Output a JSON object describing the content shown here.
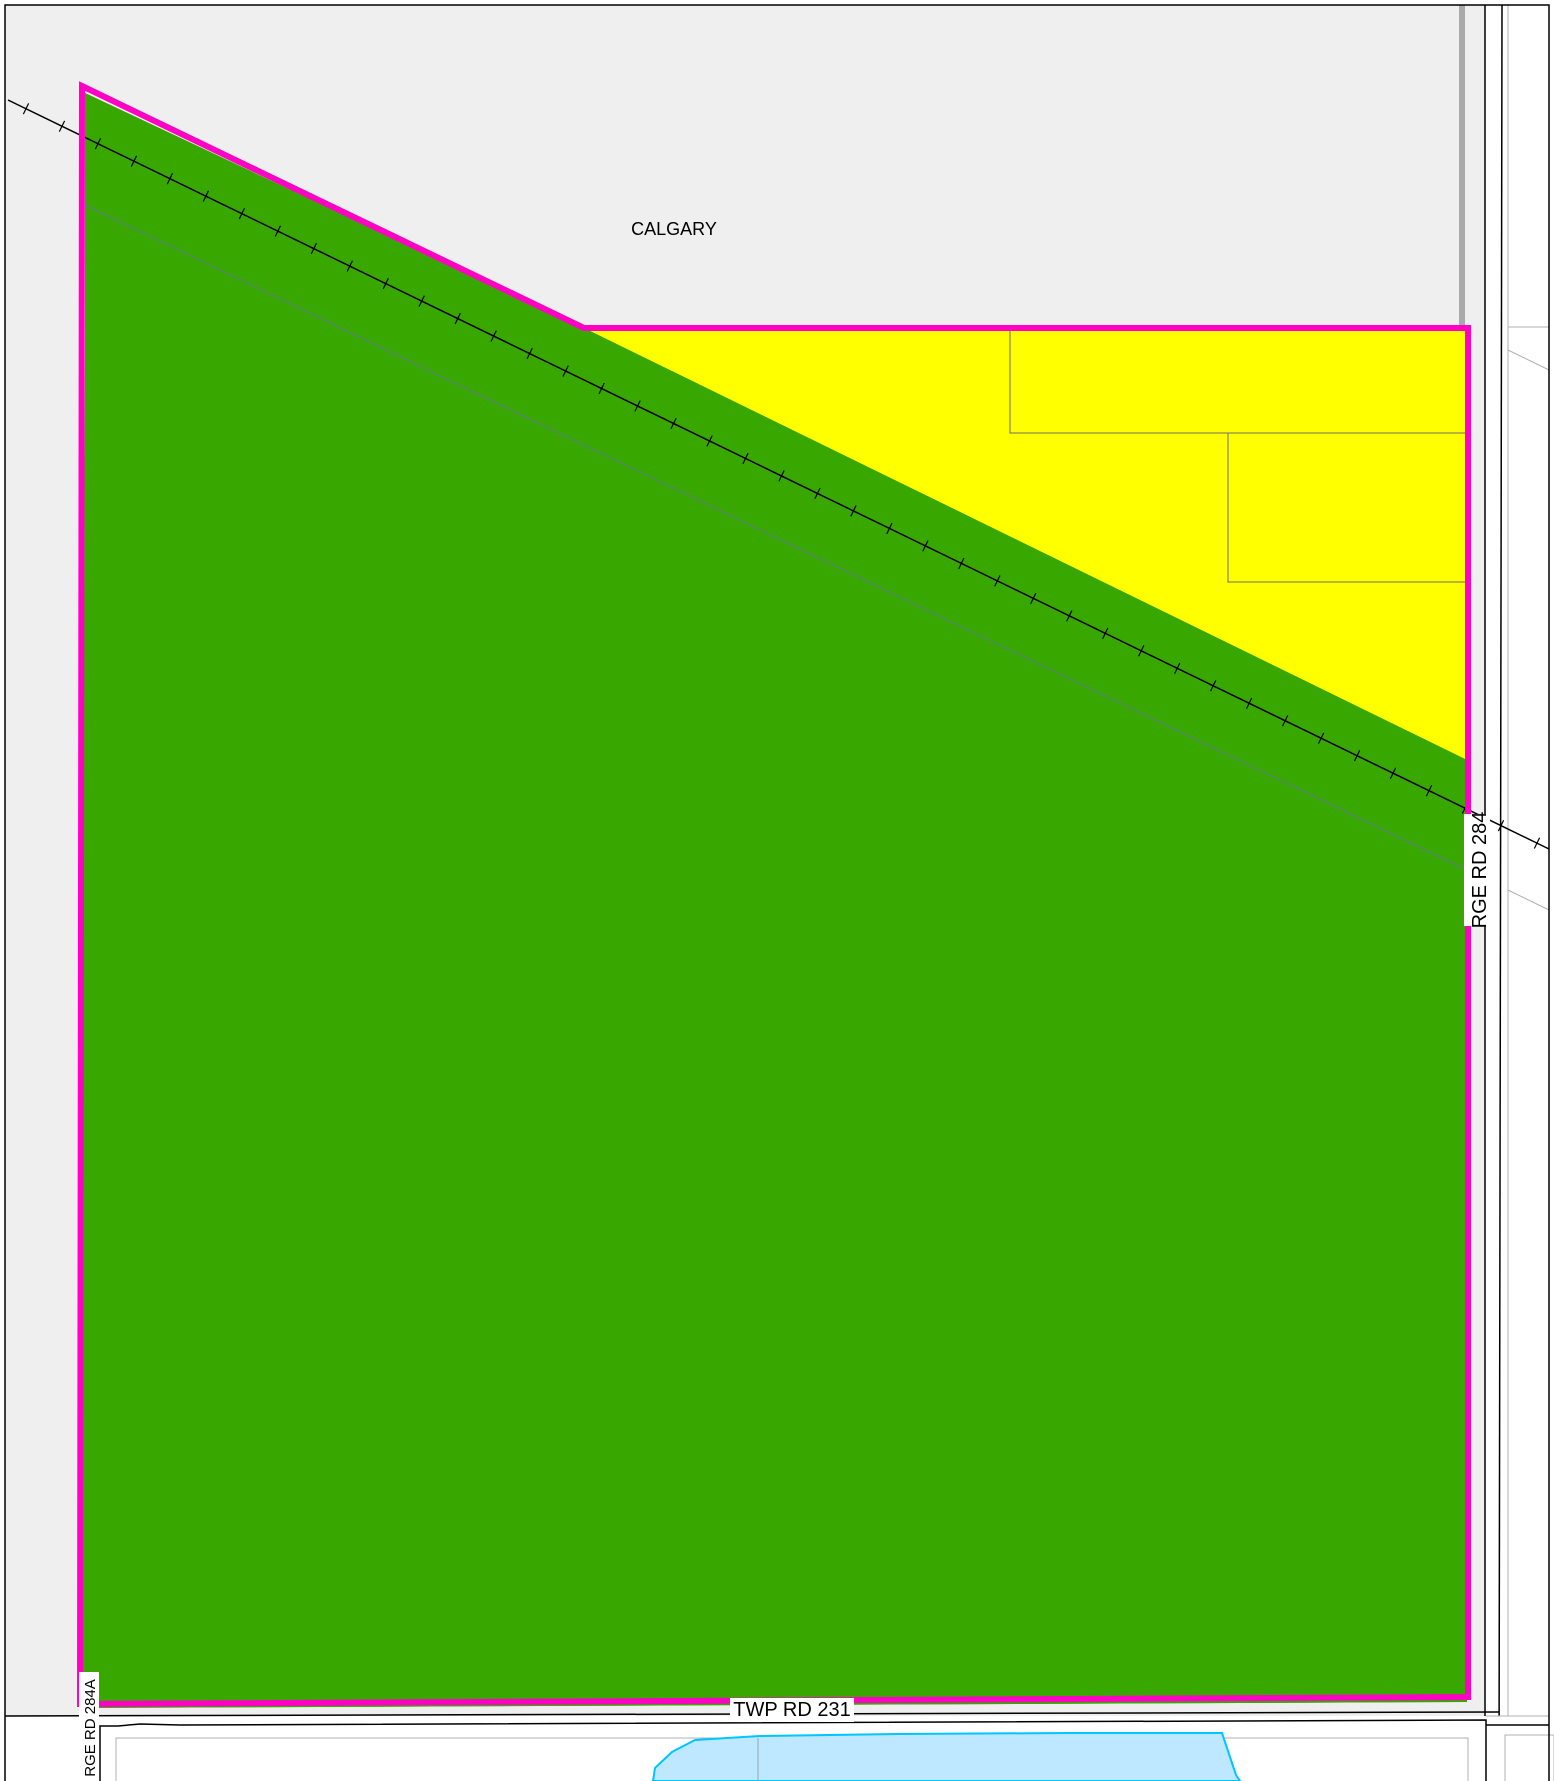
{
  "map": {
    "place_label": "CALGARY",
    "road_labels": {
      "range_road_east": "RGE RD 284",
      "township_road": "TWP RD 231",
      "range_road_west": "RGE RD 284A"
    }
  },
  "colors": {
    "city_area": "#efefef",
    "agricultural_zone": "#38a800",
    "residential_zone": "#ffff00",
    "water": "#bee8ff",
    "water_outline": "#00c5ff",
    "subject_boundary": "#ff00c5",
    "railway": "#000000",
    "parcel_line": "#6e6e6e"
  }
}
